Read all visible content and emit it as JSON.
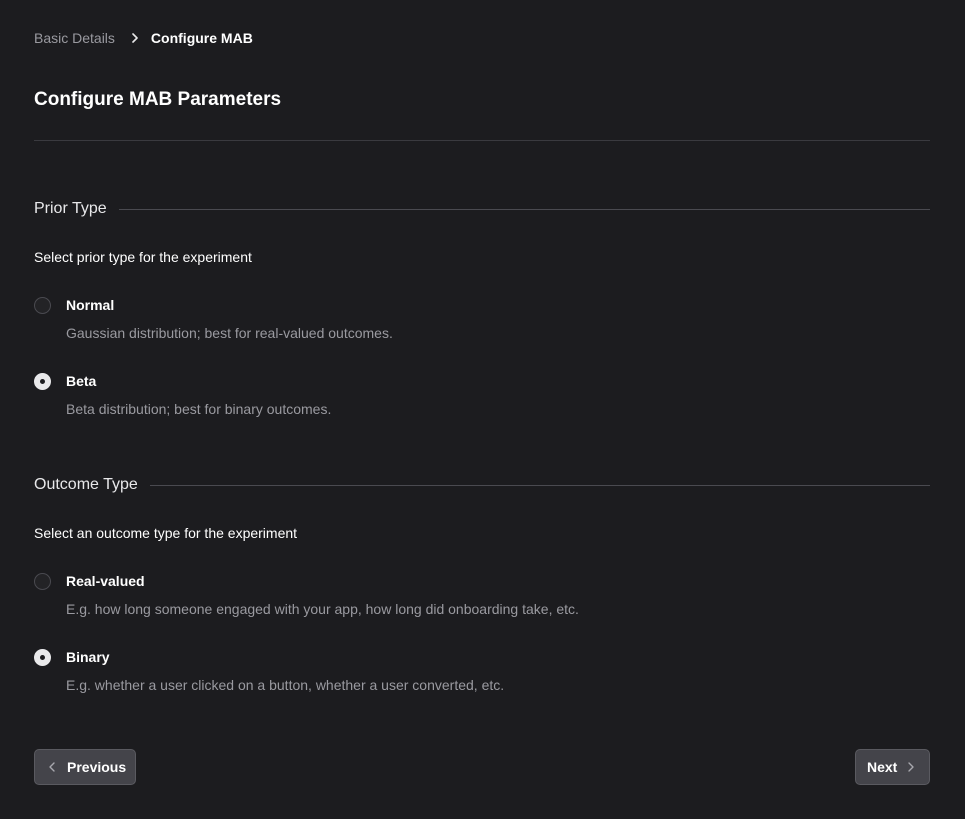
{
  "breadcrumb": {
    "previous": "Basic Details",
    "current": "Configure MAB",
    "separator_icon": "chevron-right-icon"
  },
  "page": {
    "title": "Configure MAB Parameters"
  },
  "prior_type": {
    "title": "Prior Type",
    "description": "Select prior type for the experiment",
    "selected": "Beta",
    "options": [
      {
        "label": "Normal",
        "description": "Gaussian distribution; best for real-valued outcomes.",
        "checked": false
      },
      {
        "label": "Beta",
        "description": "Beta distribution; best for binary outcomes.",
        "checked": true
      }
    ]
  },
  "outcome_type": {
    "title": "Outcome Type",
    "description": "Select an outcome type for the experiment",
    "selected": "Binary",
    "options": [
      {
        "label": "Real-valued",
        "description": "E.g. how long someone engaged with your app, how long did onboarding take, etc.",
        "checked": false
      },
      {
        "label": "Binary",
        "description": "E.g. whether a user clicked on a button, whether a user converted, etc.",
        "checked": true
      }
    ]
  },
  "navigation": {
    "previous_label": "Previous",
    "next_label": "Next"
  },
  "colors": {
    "background": "#1c1c1f",
    "text_primary": "#ffffff",
    "text_muted": "#9a9aa0",
    "button_bg": "#44444a",
    "divider": "#3a3a3f"
  }
}
